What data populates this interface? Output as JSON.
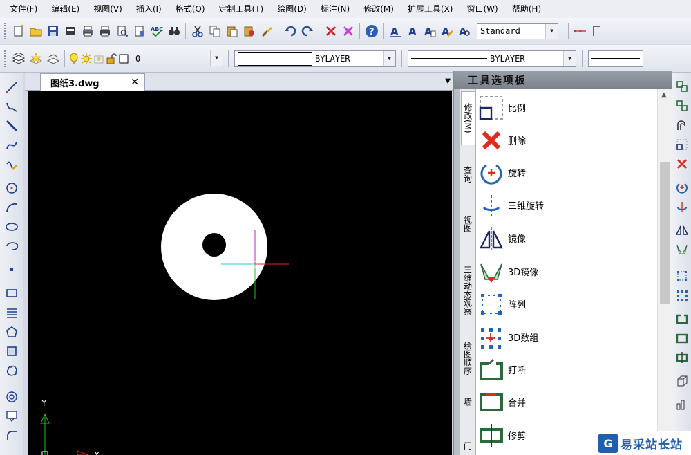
{
  "menu": {
    "items": [
      {
        "label": "文件(F)"
      },
      {
        "label": "编辑(E)"
      },
      {
        "label": "视图(V)"
      },
      {
        "label": "插入(I)"
      },
      {
        "label": "格式(O)"
      },
      {
        "label": "定制工具(T)"
      },
      {
        "label": "绘图(D)"
      },
      {
        "label": "标注(N)"
      },
      {
        "label": "修改(M)"
      },
      {
        "label": "扩展工具(X)"
      },
      {
        "label": "窗口(W)"
      },
      {
        "label": "帮助(H)"
      }
    ]
  },
  "toolbar": {
    "text_style_value": "Standard",
    "layer_value": "0",
    "color_value": "BYLAYER",
    "linetype_value": "BYLAYER",
    "accent": "#1d3f8c"
  },
  "document": {
    "tab_label": "图纸3.dwg",
    "close_glyph": "✕"
  },
  "canvas": {
    "ucs_y_label": "Y",
    "ucs_x_label": "X",
    "background": "#000000",
    "shape_color": "#ffffff"
  },
  "palette": {
    "title": "工具选项板",
    "tabs": [
      {
        "label": "修改(M)",
        "active": true
      },
      {
        "label": "查询",
        "active": false
      },
      {
        "label": "视图",
        "active": false
      },
      {
        "label": "三维动态观察",
        "active": false
      },
      {
        "label": "绘图顺序",
        "active": false
      },
      {
        "label": "墙",
        "active": false
      },
      {
        "label": "门",
        "active": false
      }
    ],
    "items": [
      {
        "label": "比例",
        "icon": "scale-icon"
      },
      {
        "label": "删除",
        "icon": "erase-icon"
      },
      {
        "label": "旋转",
        "icon": "rotate-icon"
      },
      {
        "label": "三维旋转",
        "icon": "rotate-3d-icon"
      },
      {
        "label": "镜像",
        "icon": "mirror-icon"
      },
      {
        "label": "3D镜像",
        "icon": "mirror-3d-icon"
      },
      {
        "label": "阵列",
        "icon": "array-icon"
      },
      {
        "label": "3D数组",
        "icon": "array-3d-icon"
      },
      {
        "label": "打断",
        "icon": "break-icon"
      },
      {
        "label": "合并",
        "icon": "join-icon"
      },
      {
        "label": "修剪",
        "icon": "trim-icon"
      }
    ]
  },
  "watermark": {
    "logo_glyph": "G",
    "text": "易采站长站"
  }
}
